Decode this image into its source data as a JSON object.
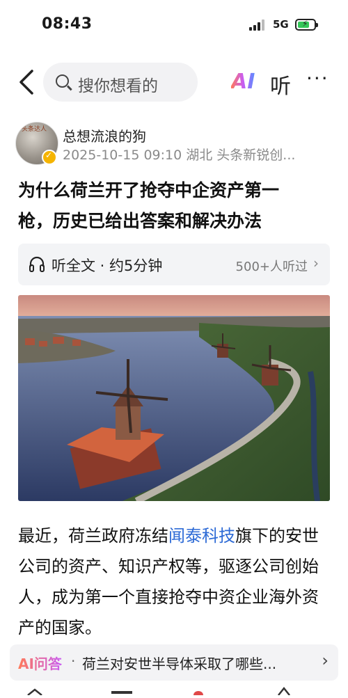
{
  "status_bar": {
    "time": "08:43",
    "network": "5G",
    "battery_charging": true
  },
  "nav": {
    "search_placeholder": "搜你想看的",
    "ai_label": "AI",
    "listen_label": "听",
    "more_label": "···",
    "icons": [
      "back-chevron-icon",
      "search-icon",
      "more-icon"
    ]
  },
  "author": {
    "name": "总想流浪的狗",
    "meta": "2025-10-15 09:10 湖北 头条新锐创...",
    "avatar_stamp": "头条达人"
  },
  "article": {
    "title_line1": "为什么荷兰开了抢夺中企资产第一",
    "title_line2": "枪，历史已给出答案和解决办法",
    "audio": {
      "label": "听全文 · 约5分钟",
      "count": "500+人听过",
      "chevron": "›"
    },
    "body": {
      "p1_before": "最近，荷兰政府冻结",
      "p1_link": "闻泰科技",
      "p1_after": "旗下的安世公司的资产、知识产权等，驱逐公司创始人，成为第一个直接抢夺中资企业海外资产的国家。"
    }
  },
  "ai_ask": {
    "label": "AI问答",
    "dot": "·",
    "question": "荷兰对安世半导体采取了哪些...",
    "chevron": "›"
  },
  "colors": {
    "link": "#2e6bd6",
    "muted": "#8a8a8a",
    "ai_gradient_start": "#ff7a59",
    "ai_gradient_end": "#5b8cff"
  }
}
